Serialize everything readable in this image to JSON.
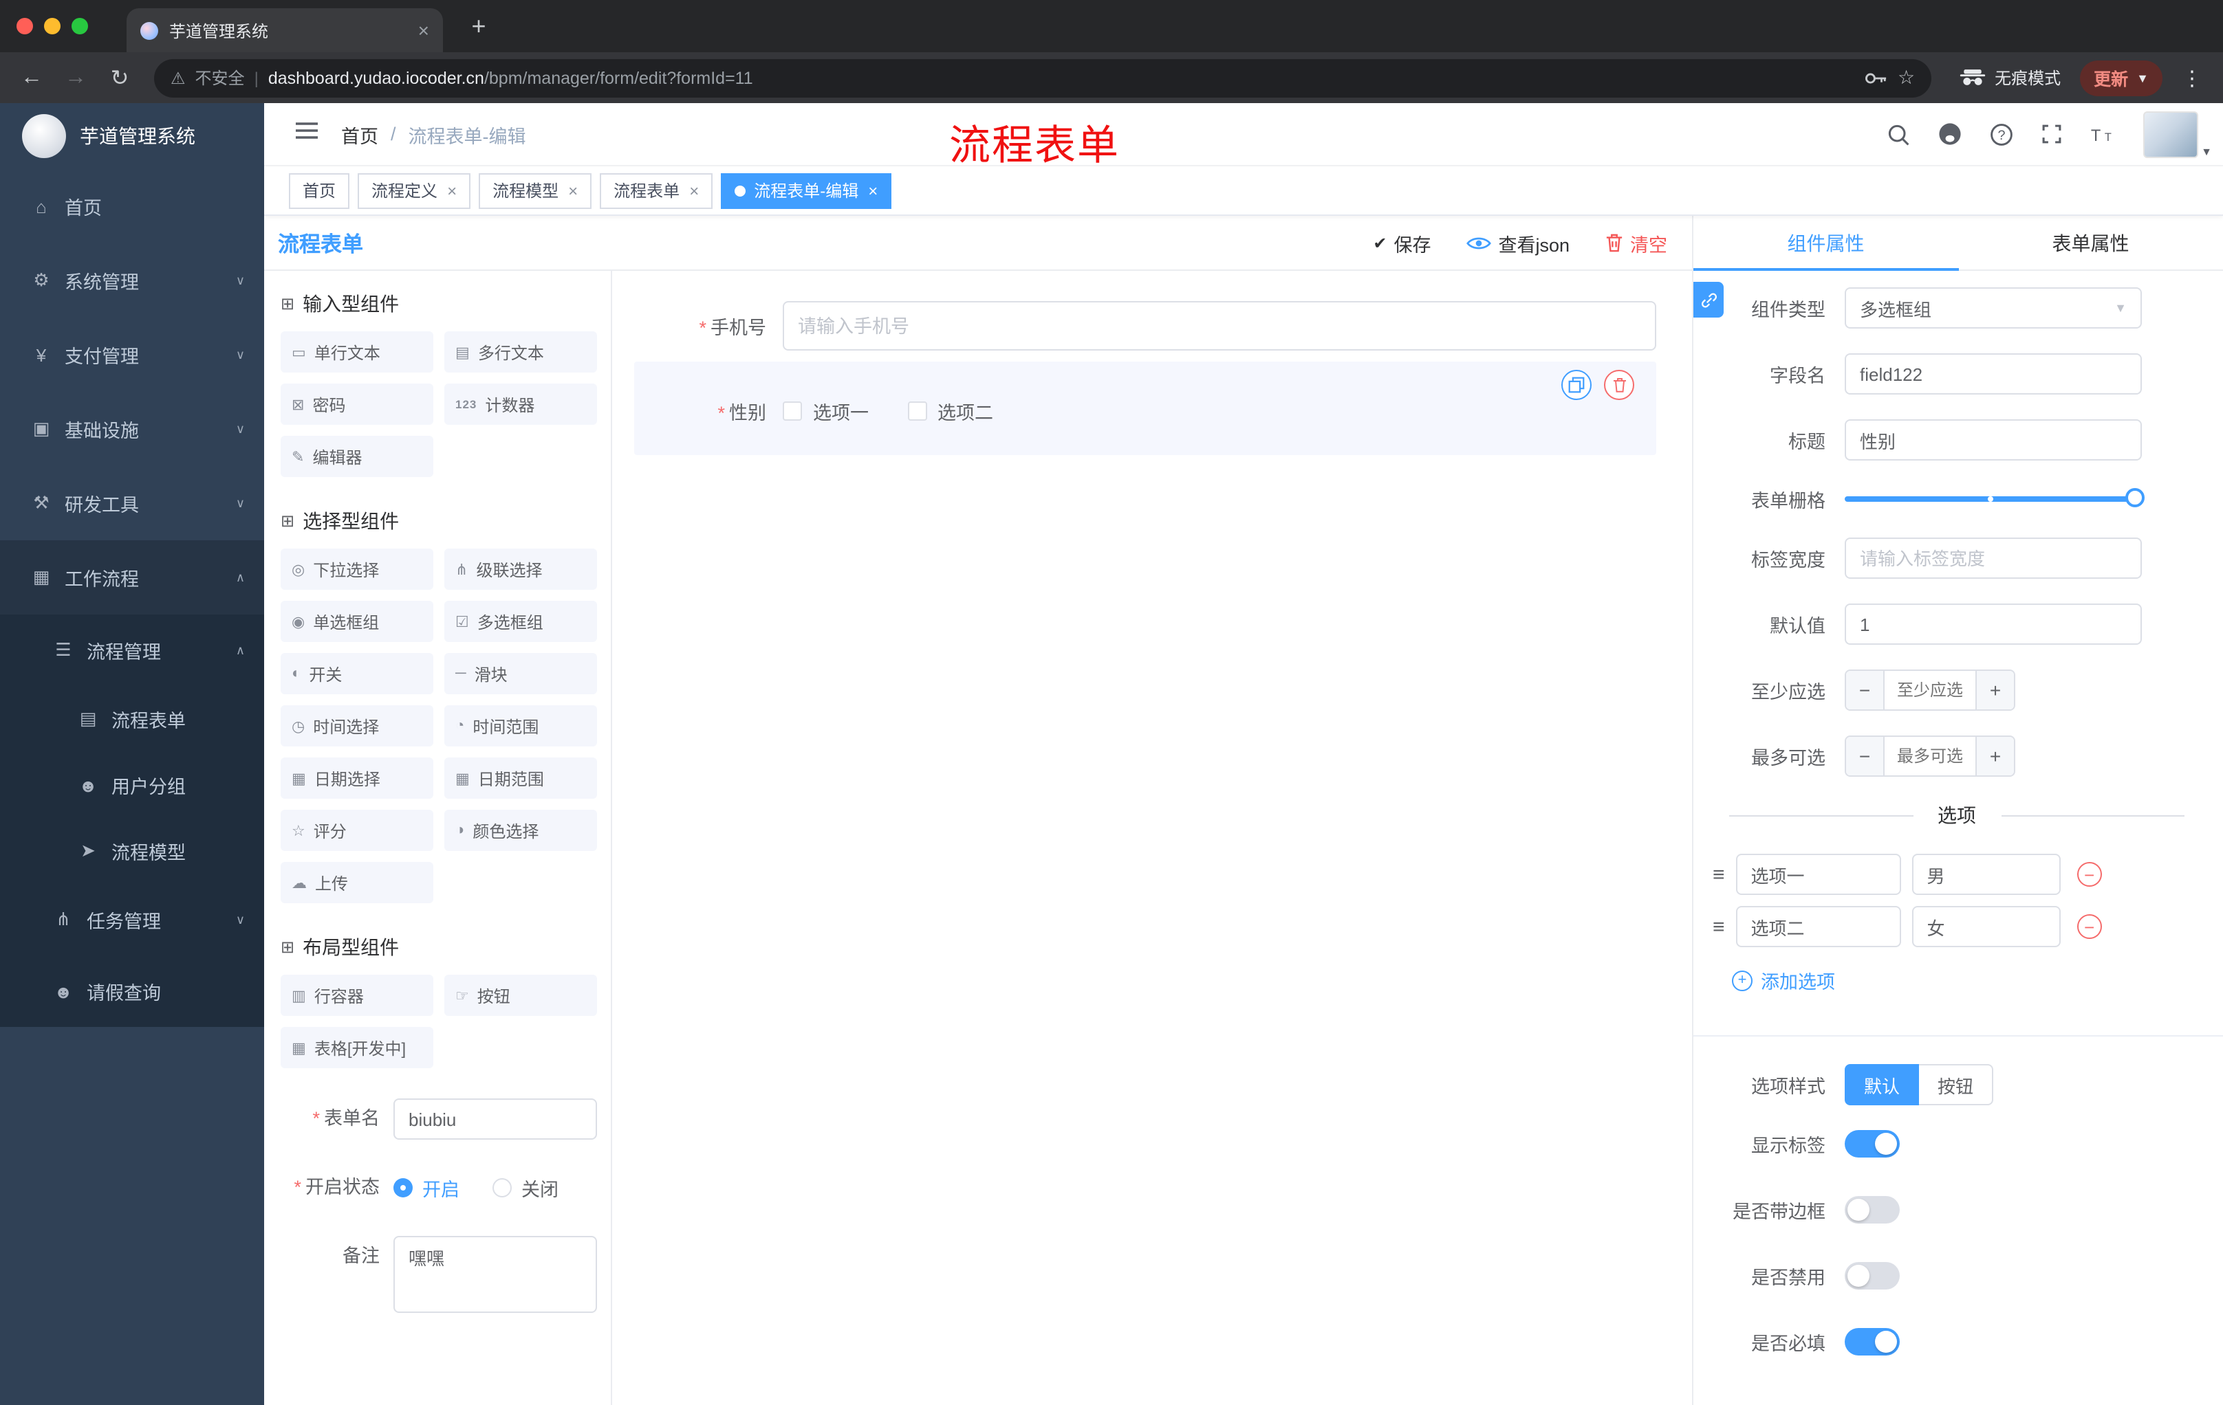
{
  "colors": {
    "accent": "#409eff",
    "danger": "#f56c6c",
    "active_tag": "#409eff",
    "sidebar_bg": "#304156",
    "submenu_bg": "#1f2d3d",
    "red_watermark": "#f01111"
  },
  "browser": {
    "tab_title": "芋道管理系统",
    "security_label": "不安全",
    "url_domain": "dashboard.yudao.iocoder.cn",
    "url_path": "/bpm/manager/form/edit?formId=11",
    "incognito_label": "无痕模式",
    "update_label": "更新"
  },
  "sidebar": {
    "logo_title": "芋道管理系统",
    "items": [
      {
        "name": "home",
        "icon": "⌂",
        "label": "首页",
        "level": 0
      },
      {
        "name": "system-mgmt",
        "icon": "⚙",
        "label": "系统管理",
        "level": 0,
        "chevron": "down"
      },
      {
        "name": "payment-mgmt",
        "icon": "¥",
        "label": "支付管理",
        "level": 0,
        "chevron": "down"
      },
      {
        "name": "infrastructure",
        "icon": "▣",
        "label": "基础设施",
        "level": 0,
        "chevron": "down"
      },
      {
        "name": "dev-tools",
        "icon": "⚒",
        "label": "研发工具",
        "level": 0,
        "chevron": "down"
      },
      {
        "name": "workflow",
        "icon": "▦",
        "label": "工作流程",
        "level": 0,
        "chevron": "up",
        "open": true
      },
      {
        "name": "process-mgmt",
        "icon": "☰",
        "label": "流程管理",
        "level": 1,
        "chevron": "up"
      },
      {
        "name": "process-form",
        "icon": "▤",
        "label": "流程表单",
        "level": 2
      },
      {
        "name": "user-group",
        "icon": "☻",
        "label": "用户分组",
        "level": 2
      },
      {
        "name": "process-model",
        "icon": "➤",
        "label": "流程模型",
        "level": 2
      },
      {
        "name": "task-mgmt",
        "icon": "⋔",
        "label": "任务管理",
        "level": 1,
        "chevron": "down"
      },
      {
        "name": "leave-query",
        "icon": "☻",
        "label": "请假查询",
        "level": 1
      }
    ]
  },
  "header": {
    "breadcrumb": [
      "首页",
      "流程表单-编辑"
    ],
    "watermark": "流程表单"
  },
  "tags": [
    {
      "label": "首页",
      "active": false,
      "closable": false
    },
    {
      "label": "流程定义",
      "active": false,
      "closable": true
    },
    {
      "label": "流程模型",
      "active": false,
      "closable": true
    },
    {
      "label": "流程表单",
      "active": false,
      "closable": true
    },
    {
      "label": "流程表单-编辑",
      "active": true,
      "closable": true
    }
  ],
  "designer": {
    "title": "流程表单",
    "actions": {
      "save": "保存",
      "view_json": "查看json",
      "clear": "清空"
    },
    "palette_sections": [
      {
        "title": "输入型组件",
        "items": [
          {
            "label": "单行文本",
            "icon": "▭"
          },
          {
            "label": "多行文本",
            "icon": "▤"
          },
          {
            "label": "密码",
            "icon": "⊠"
          },
          {
            "label": "计数器",
            "icon": "123"
          },
          {
            "label": "编辑器",
            "icon": "✎"
          }
        ]
      },
      {
        "title": "选择型组件",
        "items": [
          {
            "label": "下拉选择",
            "icon": "◎"
          },
          {
            "label": "级联选择",
            "icon": "⋔"
          },
          {
            "label": "单选框组",
            "icon": "◉"
          },
          {
            "label": "多选框组",
            "icon": "☑"
          },
          {
            "label": "开关",
            "icon": "◐"
          },
          {
            "label": "滑块",
            "icon": "─"
          },
          {
            "label": "时间选择",
            "icon": "◷"
          },
          {
            "label": "时间范围",
            "icon": "◔"
          },
          {
            "label": "日期选择",
            "icon": "▦"
          },
          {
            "label": "日期范围",
            "icon": "▦"
          },
          {
            "label": "评分",
            "icon": "☆"
          },
          {
            "label": "颜色选择",
            "icon": "◑"
          },
          {
            "label": "上传",
            "icon": "☁"
          }
        ]
      },
      {
        "title": "布局型组件",
        "items": [
          {
            "label": "行容器",
            "icon": "▥"
          },
          {
            "label": "按钮",
            "icon": "☞"
          },
          {
            "label": "表格[开发中]",
            "icon": "▦"
          }
        ]
      }
    ],
    "meta": {
      "name_label": "表单名",
      "name_value": "biubiu",
      "status_label": "开启状态",
      "status_options": [
        {
          "label": "开启",
          "selected": true
        },
        {
          "label": "关闭",
          "selected": false
        }
      ],
      "remark_label": "备注",
      "remark_value": "嘿嘿"
    },
    "canvas": {
      "phone": {
        "label": "手机号",
        "required": true,
        "placeholder": "请输入手机号",
        "value": ""
      },
      "gender": {
        "label": "性别",
        "required": true,
        "options": [
          "选项一",
          "选项二"
        ],
        "checked": [
          false,
          false
        ]
      }
    },
    "props": {
      "tabs": [
        {
          "label": "组件属性",
          "active": true
        },
        {
          "label": "表单属性",
          "active": false
        }
      ],
      "fields": {
        "component_type": {
          "label": "组件类型",
          "value": "多选框组"
        },
        "field_name": {
          "label": "字段名",
          "value": "field122"
        },
        "title": {
          "label": "标题",
          "value": "性别"
        },
        "grid": {
          "label": "表单栅格"
        },
        "label_width": {
          "label": "标签宽度",
          "placeholder": "请输入标签宽度"
        },
        "default_value": {
          "label": "默认值",
          "value": "1"
        },
        "min_select": {
          "label": "至少应选",
          "placeholder": "至少应选"
        },
        "max_select": {
          "label": "最多可选",
          "placeholder": "最多可选"
        }
      },
      "options_title": "选项",
      "options": [
        {
          "label": "选项一",
          "value": "男"
        },
        {
          "label": "选项二",
          "value": "女"
        }
      ],
      "add_option_label": "添加选项",
      "option_style": {
        "label": "选项样式",
        "choices": [
          {
            "label": "默认",
            "active": true
          },
          {
            "label": "按钮",
            "active": false
          }
        ]
      },
      "switches": [
        {
          "label": "显示标签",
          "on": true
        },
        {
          "label": "是否带边框",
          "on": false
        },
        {
          "label": "是否禁用",
          "on": false
        },
        {
          "label": "是否必填",
          "on": true
        }
      ]
    }
  }
}
